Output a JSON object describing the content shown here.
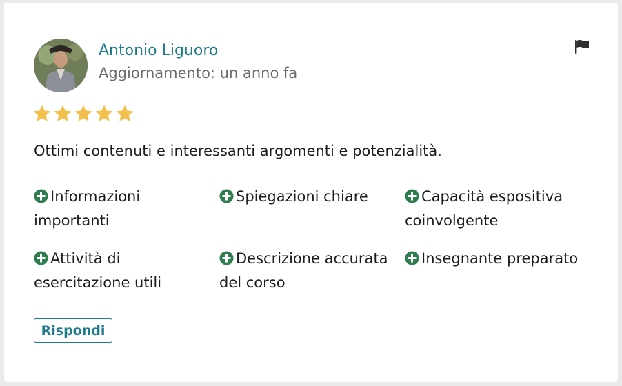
{
  "review": {
    "author": "Antonio Liguoro",
    "updated": "Aggiornamento: un anno fa",
    "rating": 5,
    "rating_max": 5,
    "comment": "Ottimi contenuti e interessanti argomenti e potenzialità.",
    "tags": [
      {
        "label": "Informazioni importanti"
      },
      {
        "label": "Spiegazioni chiare"
      },
      {
        "label": "Capacità espositiva coinvolgente"
      },
      {
        "label": "Attività di esercitazione utili"
      },
      {
        "label": "Descrizione accurata del corso"
      },
      {
        "label": "Insegnante preparato"
      }
    ],
    "reply_label": "Rispondi"
  },
  "icons": {
    "flag": "flag-icon",
    "star": "star-icon",
    "tag": "plus-circle-icon"
  },
  "colors": {
    "link": "#1f7c8c",
    "muted": "#6a6f73",
    "star": "#f3c04e",
    "tag_icon": "#2e7d4f",
    "flag": "#2d2f31"
  }
}
